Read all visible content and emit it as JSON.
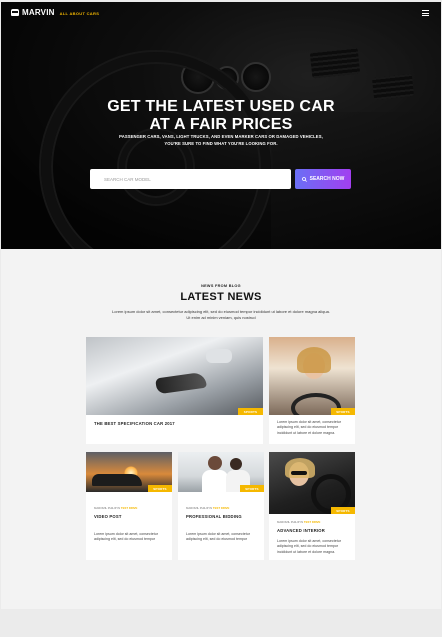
{
  "nav": {
    "logo_name": "MARVIN",
    "logo_tagline": "ALL ABOUT CARS"
  },
  "hero": {
    "title_line1": "GET THE LATEST USED CAR",
    "title_line2": "AT A FAIR PRICES",
    "subtitle_line1": "PASSENGER CARS, VANS, LIGHT TRUCKS, AND EVEN MARKER CARS OR DAMAGED VEHICLES,",
    "subtitle_line2": "YOU'RE SURE TO FIND WHAT YOU'RE LOOKING FOR.",
    "search_placeholder": "SEARCH CAR MODEL",
    "search_button": "SEARCH NOW"
  },
  "news": {
    "kicker": "NEWS FROM BLOG",
    "title": "LATEST NEWS",
    "desc_line1": "Lorem ipsum dolor sit amet, consectetur adipiscing elit, sed do eiusmod tempor incididunt ut labore et dolore magna aliqua.",
    "desc_line2": "Ut enim ad minim veniam, quis nostrud"
  },
  "cards": [
    {
      "badge": "SPORTS",
      "title": "THE BEST SPECIFICATION CAR 2017"
    },
    {
      "badge": "SPORTS",
      "desc_line1": "Lorem ipsum dolor sit amet, consectetur",
      "desc_line2": "adipiscing elit, sed do eiusmod tempor",
      "desc_line3": "incididunt ut labore et dolore magna."
    },
    {
      "badge": "SPORTS",
      "meta_prefix": "MAROMIL PHILIP IN",
      "meta_link": "TEST DRIVE",
      "title": "VIDEO POST",
      "desc_line1": "Lorem ipsum dolor sit amet, consectetur",
      "desc_line2": "adipiscing elit, sed do eiusmod tempor"
    },
    {
      "badge": "SPORTS",
      "meta_prefix": "MAROMIL PHILIP IN",
      "meta_link": "TEST DRIVE",
      "title": "PROFESSIONAL BIDDING",
      "desc_line1": "Lorem ipsum dolor sit amet, consectetur",
      "desc_line2": "adipiscing elit, sed do eiusmod tempor"
    },
    {
      "badge": "SPORTS",
      "meta_prefix": "MAROMIL PHILIP IN",
      "meta_link": "TEST DRIVE",
      "title": "ADVANCED INTERIOR",
      "desc_line1": "Lorem ipsum dolor sit amet, consectetur",
      "desc_line2": "adipiscing elit, sed do eiusmod tempor",
      "desc_line3": "incididunt ut labore et dolore magna."
    }
  ],
  "colors": {
    "accent": "#f5b800",
    "button_start": "#6a6ff5",
    "button_end": "#a23ff0"
  }
}
